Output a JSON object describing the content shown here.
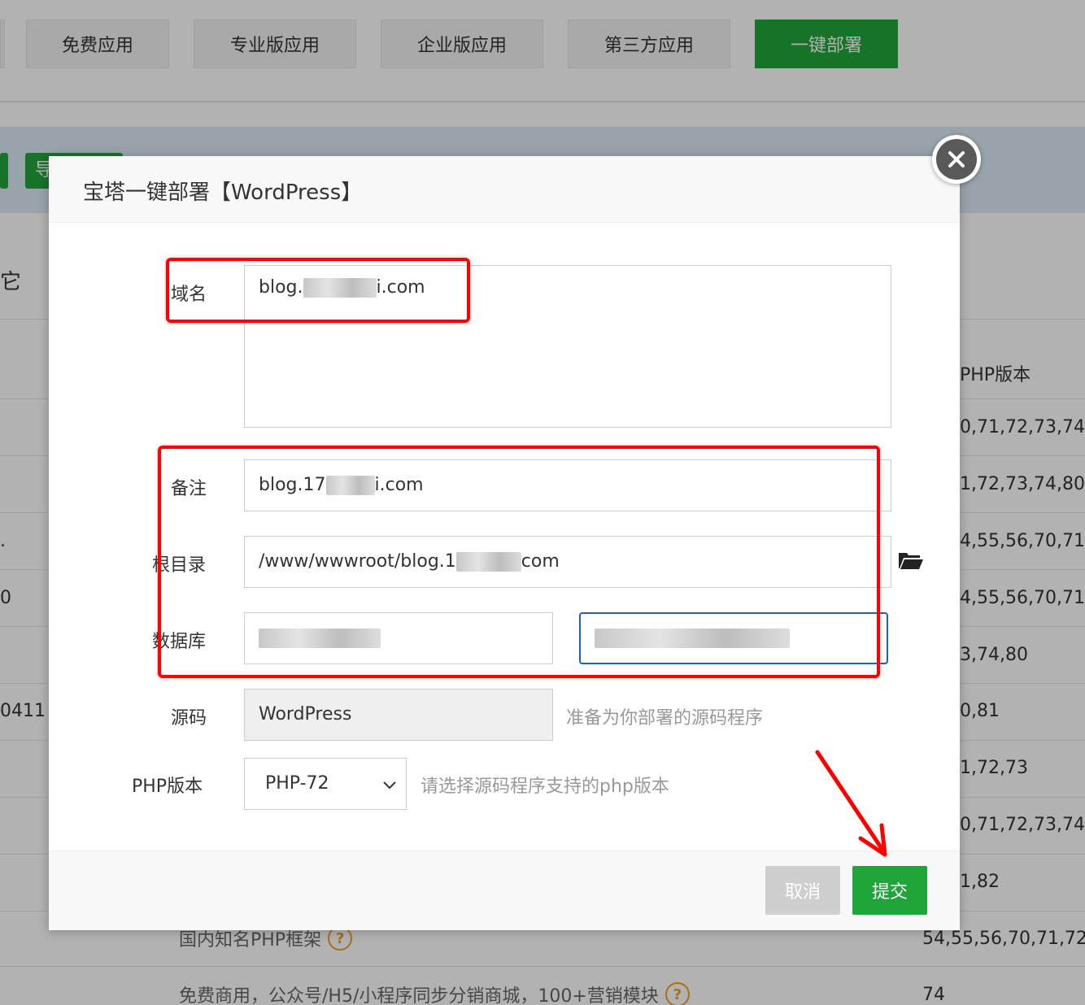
{
  "tabs": {
    "items": [
      {
        "label": "免费应用"
      },
      {
        "label": "专业版应用"
      },
      {
        "label": "企业版应用"
      },
      {
        "label": "第三方应用"
      },
      {
        "label": "一键部署",
        "active": true
      }
    ]
  },
  "background": {
    "button_partial": "导",
    "left_partial_text": "它",
    "php_version_header": "PHP版本",
    "php_versions": [
      "0,71,72,73,74,",
      "1,72,73,74,80,",
      "4,55,56,70,71,",
      "4,55,56,70,71,",
      "3,74,80",
      "0,81",
      "1,72,73",
      "0,71,72,73,74,",
      "1,82",
      "54,55,56,70,71,72",
      "74"
    ],
    "left_fragments": [
      ".",
      "0",
      "0411"
    ],
    "desc_rows": [
      {
        "text": "国内知名PHP框架",
        "help_icon": "question-circle-icon"
      },
      {
        "text": "免费商用，公众号/H5/小程序同步分销商城，100+营销模块",
        "help_icon": "question-circle-icon"
      }
    ],
    "help_glyph": "?"
  },
  "modal": {
    "title": "宝塔一键部署【WordPress】",
    "close_icon": "close-icon",
    "fields": {
      "domain": {
        "label": "域名",
        "value_prefix": "blog.",
        "value_suffix": "i.com"
      },
      "remark": {
        "label": "备注",
        "value_prefix": "blog.17",
        "value_suffix": "i.com"
      },
      "root": {
        "label": "根目录",
        "value_prefix": "/www/wwwroot/blog.1",
        "value_suffix": "com",
        "icon": "folder-open-icon"
      },
      "database": {
        "label": "数据库"
      },
      "source": {
        "label": "源码",
        "value": "WordPress",
        "hint": "准备为你部署的源码程序"
      },
      "php": {
        "label": "PHP版本",
        "selected": "PHP-72",
        "hint": "请选择源码程序支持的php版本"
      }
    },
    "buttons": {
      "cancel": "取消",
      "submit": "提交"
    }
  },
  "colors": {
    "accent_green": "#20a53a",
    "annotation_red": "#ff0000",
    "focus_blue": "#1e5fbf"
  }
}
